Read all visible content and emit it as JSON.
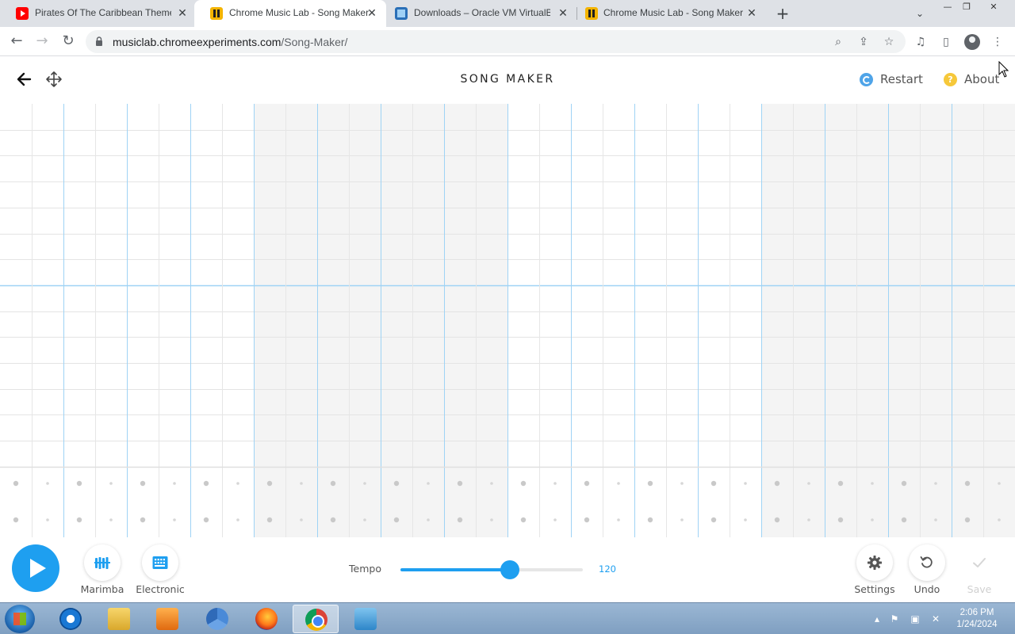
{
  "browser": {
    "tabs": [
      {
        "title": "Pirates Of The Caribbean Theme",
        "favicon": "youtube-icon",
        "active": false
      },
      {
        "title": "Chrome Music Lab - Song Maker",
        "favicon": "chrome-music-lab-icon",
        "active": true
      },
      {
        "title": "Downloads – Oracle VM VirtualBox",
        "favicon": "virtualbox-icon",
        "active": false
      },
      {
        "title": "Chrome Music Lab - Song Maker",
        "favicon": "chrome-music-lab-icon",
        "active": false
      }
    ],
    "url_host": "musiclab.chromeexperiments.com",
    "url_path": "/Song-Maker/"
  },
  "app": {
    "title": "SONG MAKER",
    "restart_label": "Restart",
    "about_label": "About"
  },
  "grid": {
    "line_color": "#9fd3f5",
    "alt_shade": "#f4f4f4"
  },
  "controls": {
    "play_icon": "play-icon",
    "instrument_label": "Marimba",
    "percussion_label": "Electronic",
    "tempo_label": "Tempo",
    "tempo_value": "120",
    "tempo_fraction": 0.6,
    "settings_label": "Settings",
    "undo_label": "Undo",
    "save_label": "Save",
    "accent_color": "#1e9ff0"
  },
  "taskbar": {
    "time": "2:06 PM",
    "date": "1/24/2024"
  }
}
